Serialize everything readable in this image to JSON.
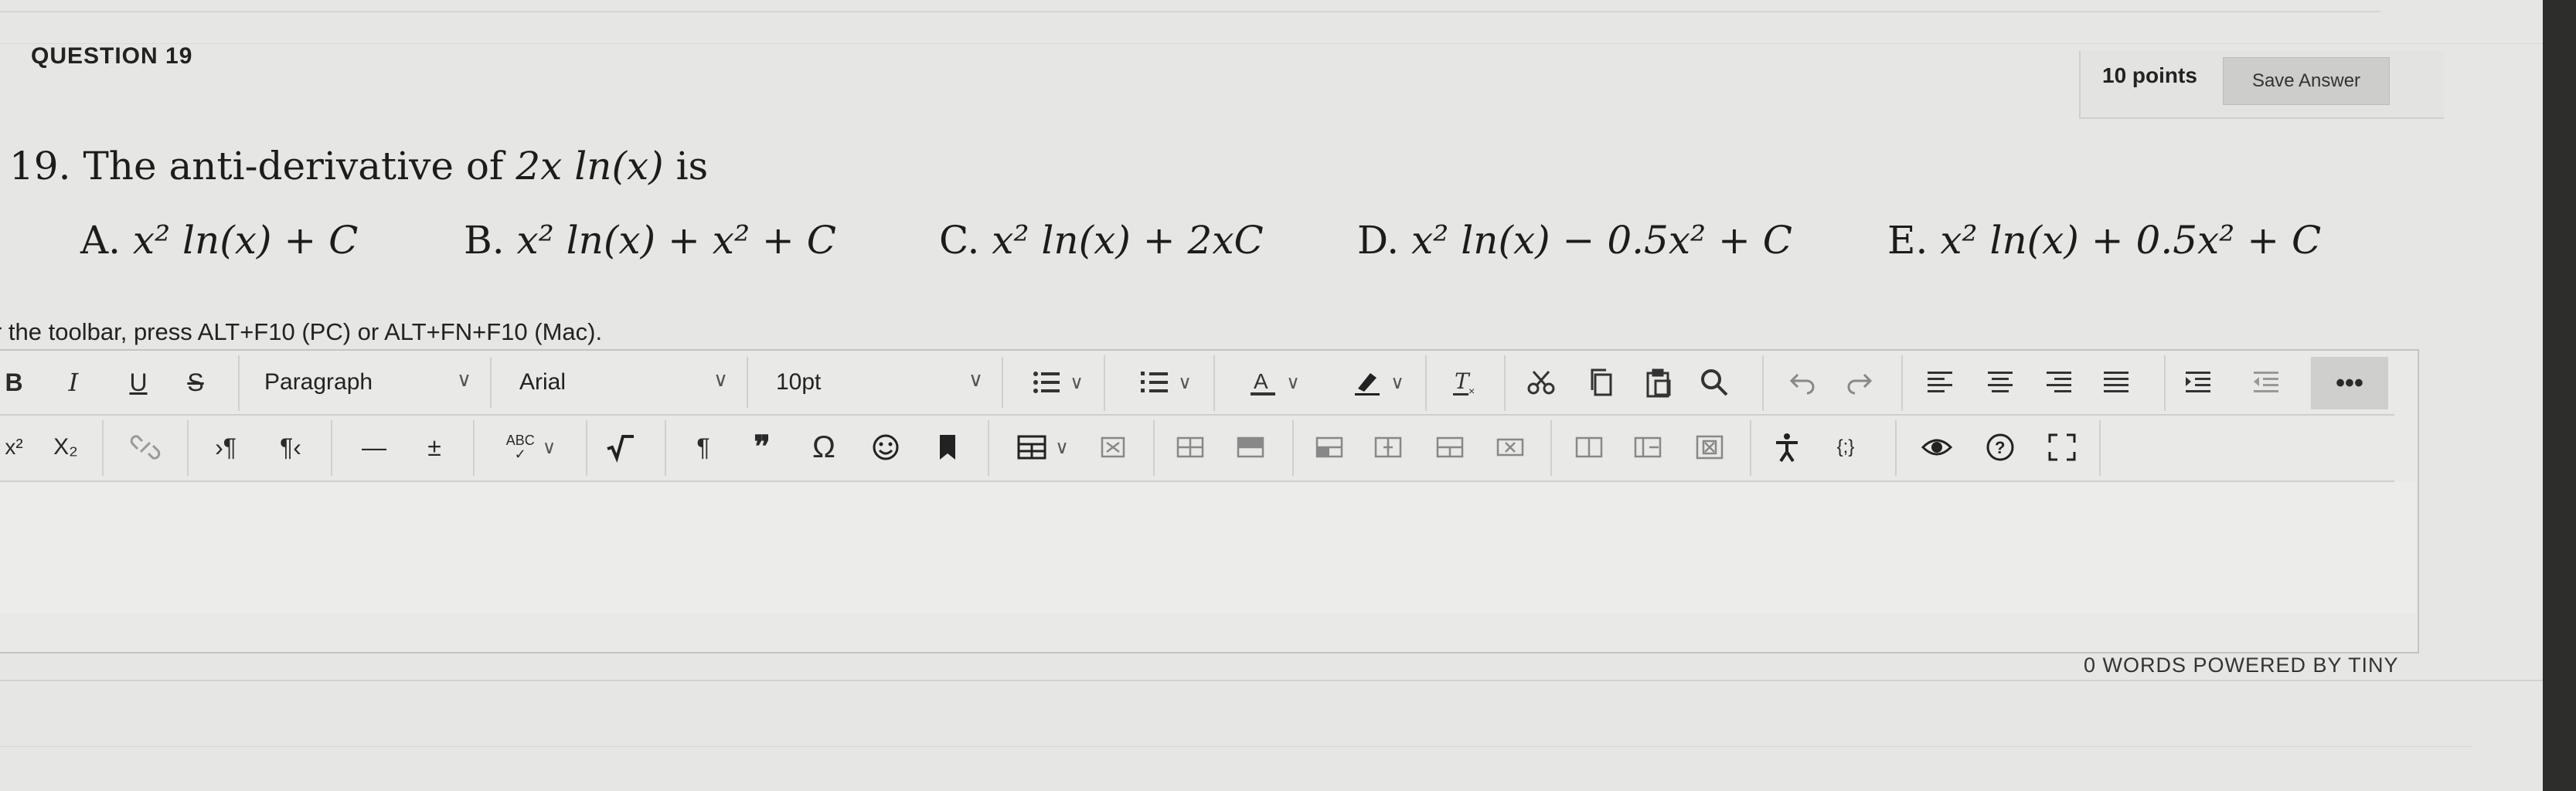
{
  "question": {
    "header": "QUESTION 19",
    "points": "10 points",
    "save_label": "Save Answer",
    "number": "19.",
    "stem_text": "The anti-derivative of",
    "stem_math": "2x ln(x)",
    "stem_end": "is",
    "choices": [
      {
        "letter": "A.",
        "math": "x² ln(x) + C"
      },
      {
        "letter": "B.",
        "math": "x² ln(x) + x² + C"
      },
      {
        "letter": "C.",
        "math": "x² ln(x) + 2xC"
      },
      {
        "letter": "D.",
        "math": "x² ln(x) − 0.5x² + C"
      },
      {
        "letter": "E.",
        "math": "x² ln(x) + 0.5x² + C"
      }
    ]
  },
  "editor": {
    "hint": "r the toolbar, press ALT+F10 (PC) or ALT+FN+F10 (Mac).",
    "toolbar1": {
      "bold": "B",
      "italic": "I",
      "underline": "U",
      "strike": "S",
      "block_format": "Paragraph",
      "font_family": "Arial",
      "font_size": "10pt",
      "more": "•••"
    },
    "toolbar2": {
      "superscript": "x²",
      "subscript": "X₂",
      "ltr": "›¶",
      "rtl": "¶‹",
      "hr": "—",
      "plusminus": "±",
      "spell_label": "ABC",
      "pilcrow": "¶",
      "quote": "❞",
      "omega": "Ω"
    },
    "status": "0 WORDS  POWERED BY TINY",
    "accent_colors": {
      "background": "#e6e6e4",
      "toolbar_border": "#cfcfcd"
    }
  }
}
